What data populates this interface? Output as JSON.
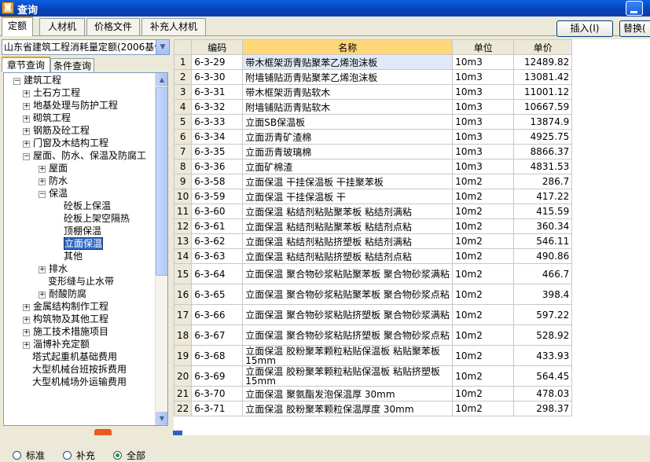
{
  "window": {
    "title": "查询",
    "icon": "app-icon"
  },
  "tabs": [
    "定额",
    "人材机",
    "价格文件",
    "补充人材机"
  ],
  "buttons": {
    "insert": "插入(I)",
    "replace": "替换("
  },
  "quota_select": {
    "value": "山东省建筑工程消耗量定额(2006基价"
  },
  "subtabs": [
    "章节查询",
    "条件查询"
  ],
  "tree": [
    {
      "label": "建筑工程",
      "level": 0,
      "exp": "−"
    },
    {
      "label": "土石方工程",
      "level": 1,
      "exp": "+"
    },
    {
      "label": "地基处理与防护工程",
      "level": 1,
      "exp": "+"
    },
    {
      "label": "砌筑工程",
      "level": 1,
      "exp": "+"
    },
    {
      "label": "钢筋及砼工程",
      "level": 1,
      "exp": "+"
    },
    {
      "label": "门窗及木结构工程",
      "level": 1,
      "exp": "+"
    },
    {
      "label": "屋面、防水、保温及防腐工",
      "level": 1,
      "exp": "−"
    },
    {
      "label": "屋面",
      "level": 2,
      "exp": "+"
    },
    {
      "label": "防水",
      "level": 2,
      "exp": "+"
    },
    {
      "label": "保温",
      "level": 2,
      "exp": "−"
    },
    {
      "label": "砼板上保温",
      "level": 3,
      "exp": ""
    },
    {
      "label": "砼板上架空隔热",
      "level": 3,
      "exp": ""
    },
    {
      "label": "顶棚保温",
      "level": 3,
      "exp": ""
    },
    {
      "label": "立面保温",
      "level": 3,
      "exp": "",
      "selected": true
    },
    {
      "label": "其他",
      "level": 3,
      "exp": ""
    },
    {
      "label": "排水",
      "level": 2,
      "exp": "+"
    },
    {
      "label": "变形缝与止水带",
      "level": 2,
      "exp": ""
    },
    {
      "label": "耐酸防腐",
      "level": 2,
      "exp": "+"
    },
    {
      "label": "金属结构制作工程",
      "level": 1,
      "exp": "+"
    },
    {
      "label": "构筑物及其他工程",
      "level": 1,
      "exp": "+"
    },
    {
      "label": "施工技术措施项目",
      "level": 1,
      "exp": "+"
    },
    {
      "label": "淄博补充定额",
      "level": 1,
      "exp": "+"
    },
    {
      "label": "塔式起重机基础费用",
      "level": 1,
      "exp": ""
    },
    {
      "label": "大型机械台班按拆费用",
      "level": 1,
      "exp": ""
    },
    {
      "label": "大型机械场外运输费用",
      "level": 1,
      "exp": ""
    }
  ],
  "filter": {
    "options": [
      "标准",
      "补充",
      "全部"
    ],
    "selected": "全部"
  },
  "table": {
    "headers": [
      "编码",
      "名称",
      "单位",
      "单价"
    ],
    "rows": [
      {
        "n": "1",
        "code": "6-3-29",
        "name": "带木框架沥青贴聚苯乙烯泡沫板",
        "unit": "10m3",
        "price": "12489.82"
      },
      {
        "n": "2",
        "code": "6-3-30",
        "name": "附墙铺贴沥青贴聚苯乙烯泡沫板",
        "unit": "10m3",
        "price": "13081.42"
      },
      {
        "n": "3",
        "code": "6-3-31",
        "name": "带木框架沥青贴软木",
        "unit": "10m3",
        "price": "11001.12"
      },
      {
        "n": "4",
        "code": "6-3-32",
        "name": "附墙铺贴沥青贴软木",
        "unit": "10m3",
        "price": "10667.59"
      },
      {
        "n": "5",
        "code": "6-3-33",
        "name": "立面SB保温板",
        "unit": "10m3",
        "price": "13874.9"
      },
      {
        "n": "6",
        "code": "6-3-34",
        "name": "立面沥青矿渣棉",
        "unit": "10m3",
        "price": "4925.75"
      },
      {
        "n": "7",
        "code": "6-3-35",
        "name": "立面沥青玻璃棉",
        "unit": "10m3",
        "price": "8866.37"
      },
      {
        "n": "8",
        "code": "6-3-36",
        "name": "立面矿棉渣",
        "unit": "10m3",
        "price": "4831.53"
      },
      {
        "n": "9",
        "code": "6-3-58",
        "name": "立面保温 干挂保温板 干挂聚苯板",
        "unit": "10m2",
        "price": "286.7"
      },
      {
        "n": "10",
        "code": "6-3-59",
        "name": "立面保温 干挂保温板 干",
        "unit": "10m2",
        "price": "417.22"
      },
      {
        "n": "11",
        "code": "6-3-60",
        "name": "立面保温 粘结剂粘贴聚苯板 粘结剂满粘",
        "unit": "10m2",
        "price": "415.59"
      },
      {
        "n": "12",
        "code": "6-3-61",
        "name": "立面保温 粘结剂粘贴聚苯板 粘结剂点粘",
        "unit": "10m2",
        "price": "360.34"
      },
      {
        "n": "13",
        "code": "6-3-62",
        "name": "立面保温 粘结剂粘贴挤塑板 粘结剂满粘",
        "unit": "10m2",
        "price": "546.11"
      },
      {
        "n": "14",
        "code": "6-3-63",
        "name": "立面保温 粘结剂粘贴挤塑板 粘结剂点粘",
        "unit": "10m2",
        "price": "490.86"
      },
      {
        "n": "15",
        "code": "6-3-64",
        "name": "立面保温 聚合物砂浆粘贴聚苯板 聚合物砂浆满粘",
        "unit": "10m2",
        "price": "466.7"
      },
      {
        "n": "16",
        "code": "6-3-65",
        "name": "立面保温 聚合物砂浆粘贴聚苯板 聚合物砂浆点粘",
        "unit": "10m2",
        "price": "398.4"
      },
      {
        "n": "17",
        "code": "6-3-66",
        "name": "立面保温 聚合物砂浆粘贴挤塑板 聚合物砂浆满粘",
        "unit": "10m2",
        "price": "597.22"
      },
      {
        "n": "18",
        "code": "6-3-67",
        "name": "立面保温 聚合物砂浆粘贴挤塑板 聚合物砂浆点粘",
        "unit": "10m2",
        "price": "528.92"
      },
      {
        "n": "19",
        "code": "6-3-68",
        "name": "立面保温 胶粉聚苯颗粒粘贴保温板 粘贴聚苯板15mm",
        "unit": "10m2",
        "price": "433.93"
      },
      {
        "n": "20",
        "code": "6-3-69",
        "name": "立面保温 胶粉聚苯颗粒粘贴保温板 粘贴挤塑板15mm",
        "unit": "10m2",
        "price": "564.45"
      },
      {
        "n": "21",
        "code": "6-3-70",
        "name": "立面保温 聚氨酯发泡保温厚 30mm",
        "unit": "10m2",
        "price": "478.03"
      },
      {
        "n": "22",
        "code": "6-3-71",
        "name": "立面保温 胶粉聚苯颗粒保温厚度 30mm",
        "unit": "10m2",
        "price": "298.37"
      }
    ]
  }
}
